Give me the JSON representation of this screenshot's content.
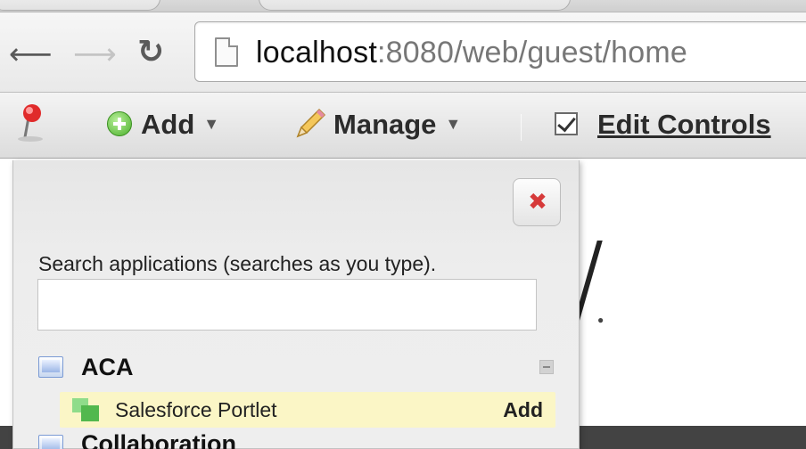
{
  "browser": {
    "url_host": "localhost",
    "url_rest": ":8080/web/guest/home",
    "icons": {
      "back": "back-arrow-icon",
      "forward": "forward-arrow-icon",
      "reload": "reload-icon",
      "page": "page-icon"
    }
  },
  "dockbar": {
    "pin_icon": "pin-icon",
    "add_label": "Add",
    "manage_label": "Manage",
    "edit_controls_label": "Edit Controls",
    "add_caret": "▼",
    "manage_caret": "▼"
  },
  "panel": {
    "close_glyph": "✖",
    "search_label": "Search applications (searches as you type).",
    "search_value": "",
    "categories": [
      {
        "title": "ACA",
        "apps": [
          {
            "label": "Salesforce Portlet",
            "action": "Add"
          }
        ]
      },
      {
        "title": "Collaboration"
      }
    ]
  },
  "colors": {
    "highlight_row": "#fbf6c6",
    "close_x": "#d63a3a",
    "add_icon_green": "#4ab02a"
  }
}
